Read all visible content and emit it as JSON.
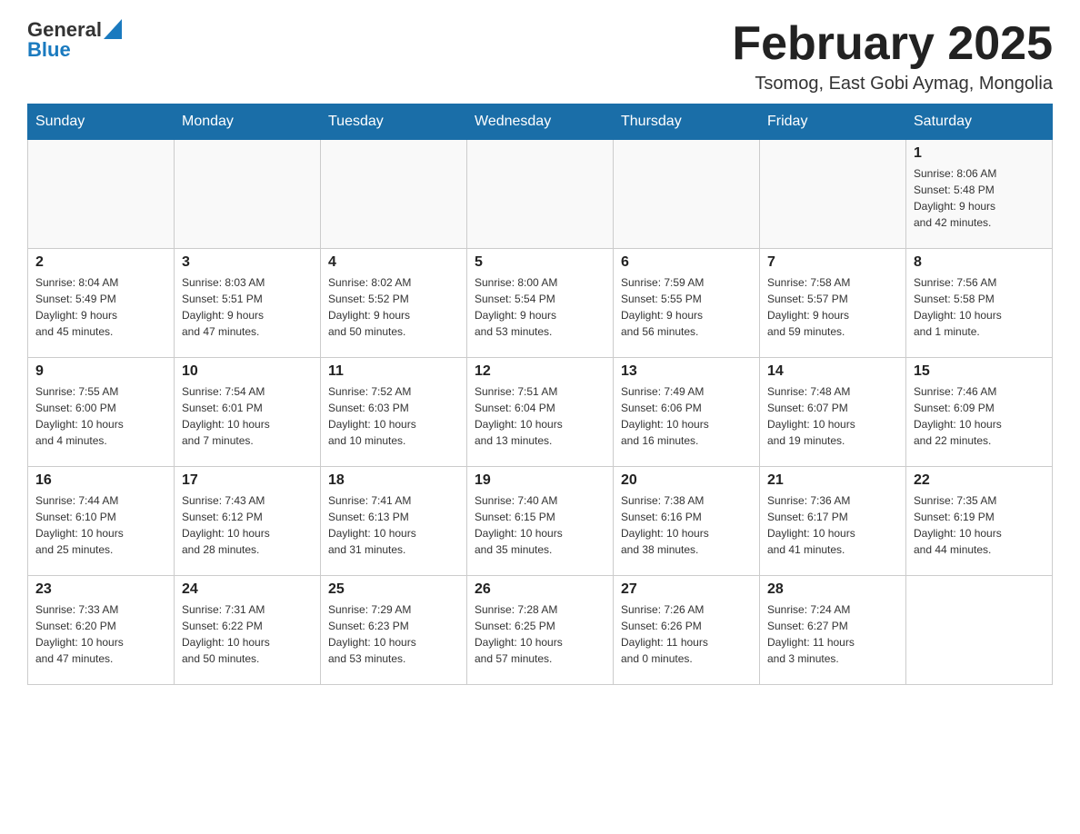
{
  "header": {
    "logo_general": "General",
    "logo_blue": "Blue",
    "month_title": "February 2025",
    "location": "Tsomog, East Gobi Aymag, Mongolia"
  },
  "days_of_week": [
    "Sunday",
    "Monday",
    "Tuesday",
    "Wednesday",
    "Thursday",
    "Friday",
    "Saturday"
  ],
  "weeks": [
    [
      {
        "day": "",
        "info": ""
      },
      {
        "day": "",
        "info": ""
      },
      {
        "day": "",
        "info": ""
      },
      {
        "day": "",
        "info": ""
      },
      {
        "day": "",
        "info": ""
      },
      {
        "day": "",
        "info": ""
      },
      {
        "day": "1",
        "info": "Sunrise: 8:06 AM\nSunset: 5:48 PM\nDaylight: 9 hours\nand 42 minutes."
      }
    ],
    [
      {
        "day": "2",
        "info": "Sunrise: 8:04 AM\nSunset: 5:49 PM\nDaylight: 9 hours\nand 45 minutes."
      },
      {
        "day": "3",
        "info": "Sunrise: 8:03 AM\nSunset: 5:51 PM\nDaylight: 9 hours\nand 47 minutes."
      },
      {
        "day": "4",
        "info": "Sunrise: 8:02 AM\nSunset: 5:52 PM\nDaylight: 9 hours\nand 50 minutes."
      },
      {
        "day": "5",
        "info": "Sunrise: 8:00 AM\nSunset: 5:54 PM\nDaylight: 9 hours\nand 53 minutes."
      },
      {
        "day": "6",
        "info": "Sunrise: 7:59 AM\nSunset: 5:55 PM\nDaylight: 9 hours\nand 56 minutes."
      },
      {
        "day": "7",
        "info": "Sunrise: 7:58 AM\nSunset: 5:57 PM\nDaylight: 9 hours\nand 59 minutes."
      },
      {
        "day": "8",
        "info": "Sunrise: 7:56 AM\nSunset: 5:58 PM\nDaylight: 10 hours\nand 1 minute."
      }
    ],
    [
      {
        "day": "9",
        "info": "Sunrise: 7:55 AM\nSunset: 6:00 PM\nDaylight: 10 hours\nand 4 minutes."
      },
      {
        "day": "10",
        "info": "Sunrise: 7:54 AM\nSunset: 6:01 PM\nDaylight: 10 hours\nand 7 minutes."
      },
      {
        "day": "11",
        "info": "Sunrise: 7:52 AM\nSunset: 6:03 PM\nDaylight: 10 hours\nand 10 minutes."
      },
      {
        "day": "12",
        "info": "Sunrise: 7:51 AM\nSunset: 6:04 PM\nDaylight: 10 hours\nand 13 minutes."
      },
      {
        "day": "13",
        "info": "Sunrise: 7:49 AM\nSunset: 6:06 PM\nDaylight: 10 hours\nand 16 minutes."
      },
      {
        "day": "14",
        "info": "Sunrise: 7:48 AM\nSunset: 6:07 PM\nDaylight: 10 hours\nand 19 minutes."
      },
      {
        "day": "15",
        "info": "Sunrise: 7:46 AM\nSunset: 6:09 PM\nDaylight: 10 hours\nand 22 minutes."
      }
    ],
    [
      {
        "day": "16",
        "info": "Sunrise: 7:44 AM\nSunset: 6:10 PM\nDaylight: 10 hours\nand 25 minutes."
      },
      {
        "day": "17",
        "info": "Sunrise: 7:43 AM\nSunset: 6:12 PM\nDaylight: 10 hours\nand 28 minutes."
      },
      {
        "day": "18",
        "info": "Sunrise: 7:41 AM\nSunset: 6:13 PM\nDaylight: 10 hours\nand 31 minutes."
      },
      {
        "day": "19",
        "info": "Sunrise: 7:40 AM\nSunset: 6:15 PM\nDaylight: 10 hours\nand 35 minutes."
      },
      {
        "day": "20",
        "info": "Sunrise: 7:38 AM\nSunset: 6:16 PM\nDaylight: 10 hours\nand 38 minutes."
      },
      {
        "day": "21",
        "info": "Sunrise: 7:36 AM\nSunset: 6:17 PM\nDaylight: 10 hours\nand 41 minutes."
      },
      {
        "day": "22",
        "info": "Sunrise: 7:35 AM\nSunset: 6:19 PM\nDaylight: 10 hours\nand 44 minutes."
      }
    ],
    [
      {
        "day": "23",
        "info": "Sunrise: 7:33 AM\nSunset: 6:20 PM\nDaylight: 10 hours\nand 47 minutes."
      },
      {
        "day": "24",
        "info": "Sunrise: 7:31 AM\nSunset: 6:22 PM\nDaylight: 10 hours\nand 50 minutes."
      },
      {
        "day": "25",
        "info": "Sunrise: 7:29 AM\nSunset: 6:23 PM\nDaylight: 10 hours\nand 53 minutes."
      },
      {
        "day": "26",
        "info": "Sunrise: 7:28 AM\nSunset: 6:25 PM\nDaylight: 10 hours\nand 57 minutes."
      },
      {
        "day": "27",
        "info": "Sunrise: 7:26 AM\nSunset: 6:26 PM\nDaylight: 11 hours\nand 0 minutes."
      },
      {
        "day": "28",
        "info": "Sunrise: 7:24 AM\nSunset: 6:27 PM\nDaylight: 11 hours\nand 3 minutes."
      },
      {
        "day": "",
        "info": ""
      }
    ]
  ]
}
